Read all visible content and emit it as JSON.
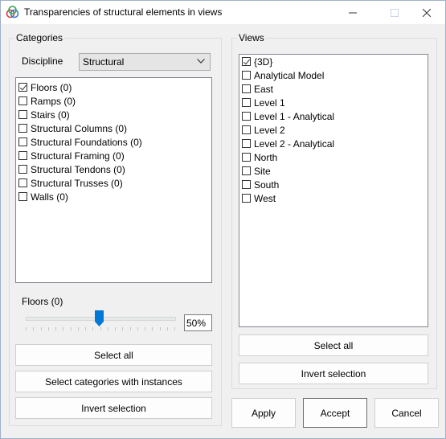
{
  "window": {
    "title": "Transparencies of structural elements in views"
  },
  "categories": {
    "group_label": "Categories",
    "discipline_label": "Discipline",
    "discipline_value": "Structural",
    "items": [
      {
        "label": "Floors (0)",
        "checked": true
      },
      {
        "label": "Ramps (0)",
        "checked": false
      },
      {
        "label": "Stairs (0)",
        "checked": false
      },
      {
        "label": "Structural Columns (0)",
        "checked": false
      },
      {
        "label": "Structural Foundations (0)",
        "checked": false
      },
      {
        "label": "Structural Framing (0)",
        "checked": false
      },
      {
        "label": "Structural Tendons (0)",
        "checked": false
      },
      {
        "label": "Structural Trusses (0)",
        "checked": false
      },
      {
        "label": "Walls (0)",
        "checked": false
      }
    ],
    "slider_label": "Floors (0)",
    "transparency_value": "50%",
    "transparency_fraction": 0.5,
    "select_all_label": "Select all",
    "select_with_instances_label": "Select categories with instances",
    "invert_selection_label": "Invert selection"
  },
  "views": {
    "group_label": "Views",
    "items": [
      {
        "label": "{3D}",
        "checked": true
      },
      {
        "label": "Analytical Model",
        "checked": false
      },
      {
        "label": "East",
        "checked": false
      },
      {
        "label": "Level 1",
        "checked": false
      },
      {
        "label": "Level 1 - Analytical",
        "checked": false
      },
      {
        "label": "Level 2",
        "checked": false
      },
      {
        "label": "Level 2 - Analytical",
        "checked": false
      },
      {
        "label": "North",
        "checked": false
      },
      {
        "label": "Site",
        "checked": false
      },
      {
        "label": "South",
        "checked": false
      },
      {
        "label": "West",
        "checked": false
      }
    ],
    "select_all_label": "Select all",
    "invert_selection_label": "Invert selection"
  },
  "footer": {
    "apply_label": "Apply",
    "accept_label": "Accept",
    "cancel_label": "Cancel"
  },
  "colors": {
    "accent": "#0078d7",
    "window_bg": "#f0f0f0"
  }
}
